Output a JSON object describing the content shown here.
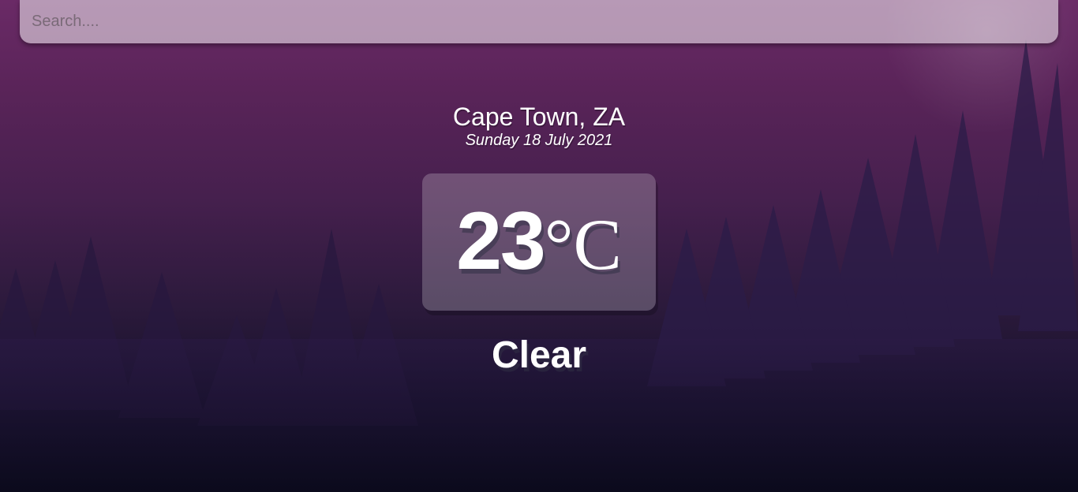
{
  "search": {
    "placeholder": "Search....",
    "value": ""
  },
  "location": {
    "city": "Cape Town, ZA",
    "date": "Sunday 18 July 2021"
  },
  "weather": {
    "temperature": "23",
    "unit": "°C",
    "condition": "Clear"
  },
  "colors": {
    "background_top": "#6a2a66",
    "background_bottom": "#0b0a1c",
    "trees": "#24173a",
    "text": "#ffffff"
  }
}
